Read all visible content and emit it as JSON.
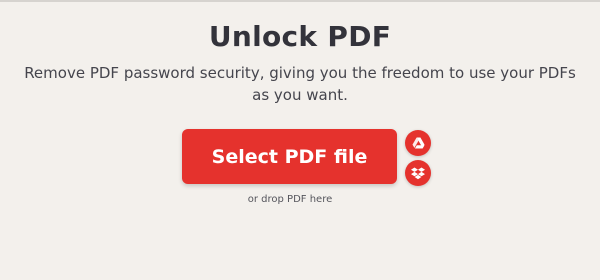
{
  "header": {
    "title": "Unlock PDF",
    "subtitle": "Remove PDF password security, giving you the freedom to use your PDFs as you want."
  },
  "upload": {
    "select_label": "Select PDF file",
    "drop_hint": "or drop PDF here",
    "cloud_sources": [
      {
        "name": "Google Drive",
        "icon": "google-drive-icon"
      },
      {
        "name": "Dropbox",
        "icon": "dropbox-icon"
      }
    ]
  },
  "colors": {
    "accent": "#e5322d",
    "background": "#f3f0ec",
    "title_text": "#33333b"
  }
}
